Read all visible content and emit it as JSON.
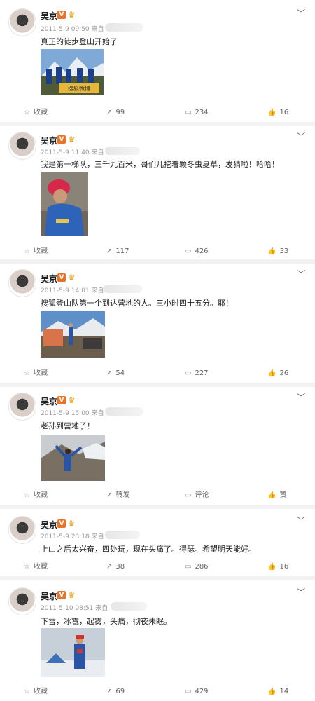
{
  "posts": [
    {
      "name": "吴京",
      "vbadge": "V",
      "crown": "♛",
      "date": "2011-5-9 09:50",
      "source": "来自",
      "text": "真正的徒步登山开始了",
      "photo_caption": "搜狐微博",
      "collect": "收藏",
      "forward": "99",
      "comment": "234",
      "like": "16"
    },
    {
      "name": "吴京",
      "vbadge": "V",
      "crown": "♛",
      "date": "2011-5-9 11:40",
      "source": "来自",
      "text": "我是第一梯队，三千九百米，哥们儿挖着颗冬虫夏草，发猜啦！哈哈！",
      "collect": "收藏",
      "forward": "117",
      "comment": "426",
      "like": "33"
    },
    {
      "name": "吴京",
      "vbadge": "V",
      "crown": "♛",
      "date": "2011-5-9 14:01",
      "source": "来自",
      "text": "搜狐登山队第一个到达营地的人。三小时四十五分。耶！",
      "collect": "收藏",
      "forward": "54",
      "comment": "227",
      "like": "26"
    },
    {
      "name": "吴京",
      "vbadge": "V",
      "crown": "♛",
      "date": "2011-5-9 15:00",
      "source": "来自",
      "text": "老孙到营地了！",
      "collect": "收藏",
      "forward": "转发",
      "comment": "评论",
      "like": "赞"
    },
    {
      "name": "吴京",
      "vbadge": "V",
      "crown": "♛",
      "date": "2011-5-9 23:18",
      "source": "来自",
      "text": "上山之后太兴奋，四处玩，现在头痛了。得瑟。希望明天能好。",
      "collect": "收藏",
      "forward": "38",
      "comment": "286",
      "like": "16"
    },
    {
      "name": "吴京",
      "vbadge": "V",
      "crown": "♛",
      "date": "2011-5-10 08:51",
      "source": "来自",
      "text": "下雪，冰雹，起雾，头痛，彻夜未眠。",
      "collect": "收藏",
      "forward": "69",
      "comment": "429",
      "like": "14"
    }
  ],
  "icons": {
    "collect": "star-icon",
    "forward": "share-icon",
    "comment": "comment-icon",
    "like": "thumb-up-icon",
    "menu": "chevron-down-icon"
  },
  "colors": {
    "badge": "#e8742a",
    "crown": "#e8a316",
    "meta": "#999999",
    "divider": "#f2f2f2"
  }
}
